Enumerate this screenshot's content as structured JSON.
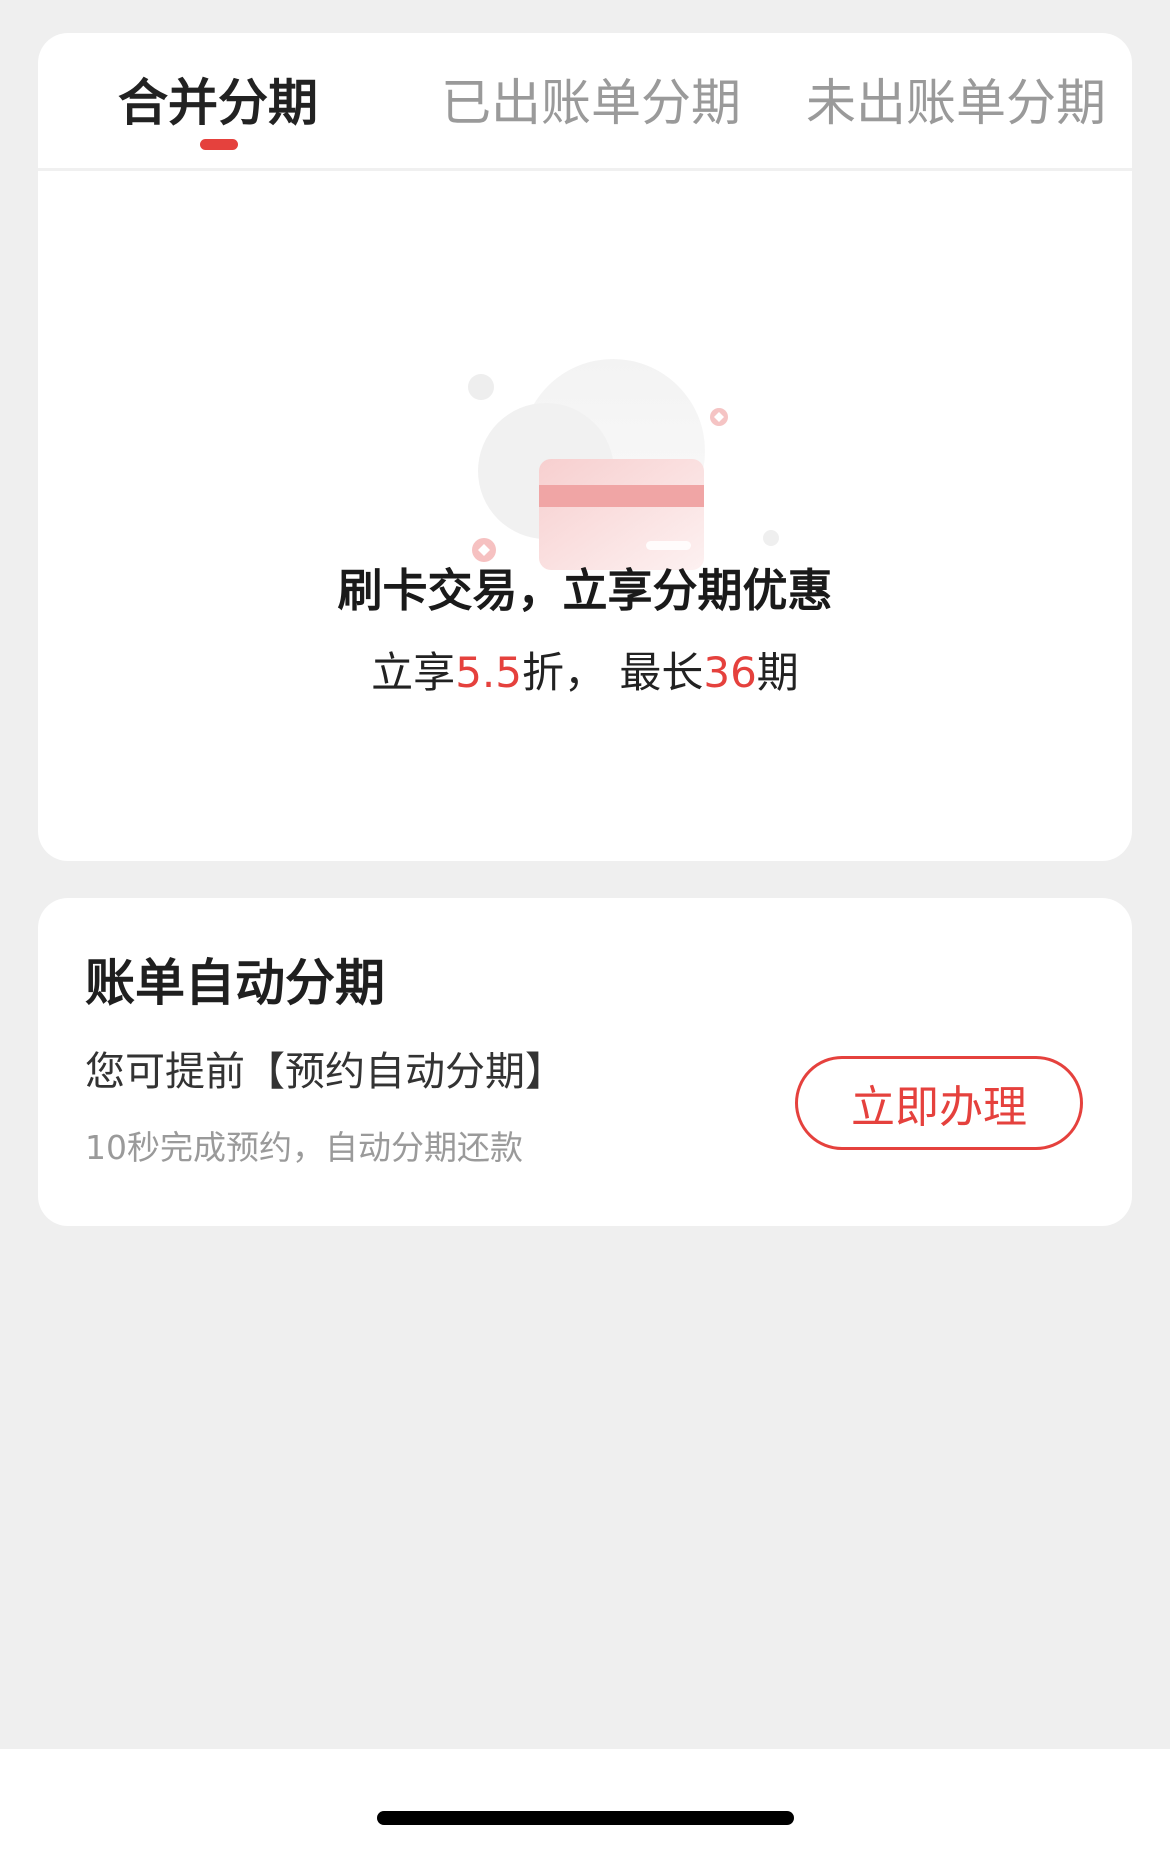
{
  "tabs": [
    {
      "label": "合并分期",
      "active": true
    },
    {
      "label": "已出账单分期",
      "active": false
    },
    {
      "label": "未出账单分期",
      "active": false
    }
  ],
  "promo": {
    "title": "刷卡交易，立享分期优惠",
    "sub_prefix": "立享",
    "discount": "5.5",
    "sub_middle": "折， 最长",
    "max_periods": "36",
    "sub_suffix": "期"
  },
  "auto_installment": {
    "title": "账单自动分期",
    "description": "您可提前【预约自动分期】",
    "note": "10秒完成预约，自动分期还款",
    "button_label": "立即办理"
  },
  "colors": {
    "accent": "#e5413d",
    "background": "#efefef",
    "card": "#ffffff"
  },
  "icons": [
    "credit-card-illustration"
  ]
}
